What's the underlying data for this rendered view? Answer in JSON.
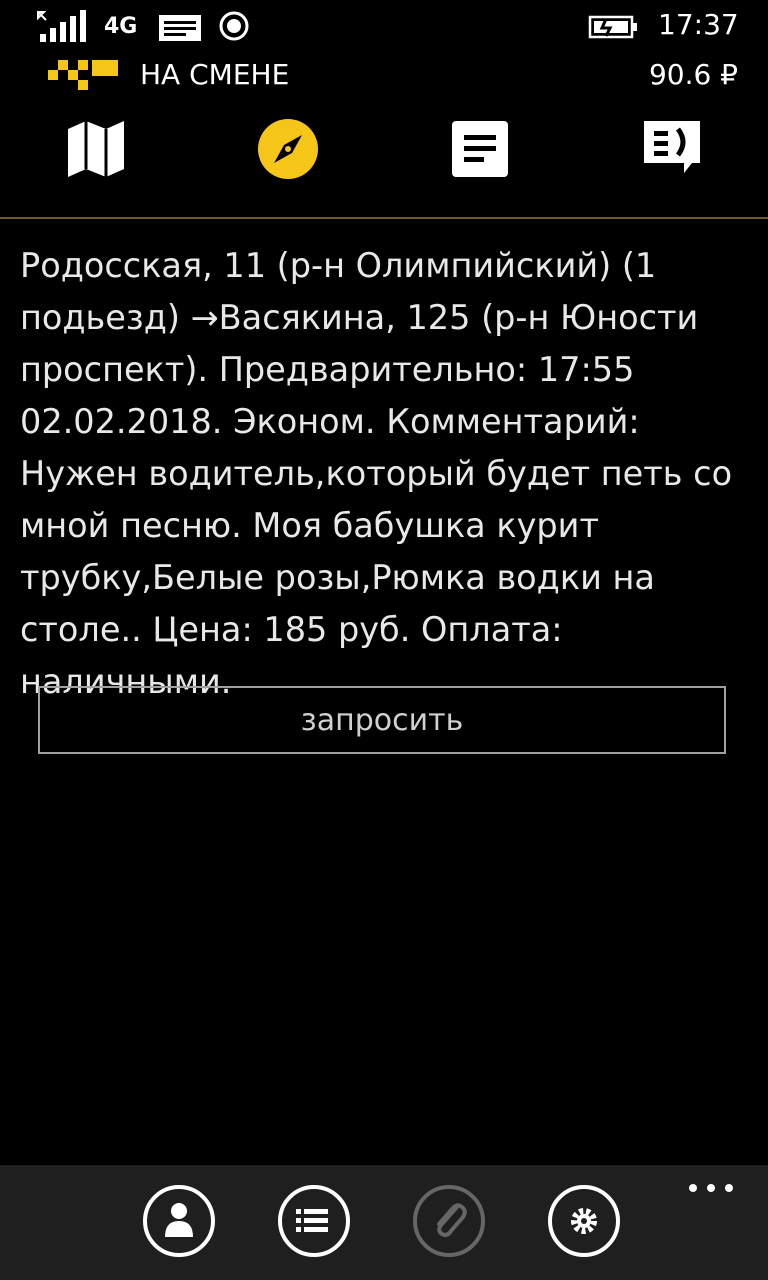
{
  "statusbar": {
    "network": "4G",
    "time": "17:37",
    "icons": [
      "signal-icon",
      "message-icon",
      "location-icon",
      "battery-charging-icon"
    ]
  },
  "header": {
    "status_text": "НА СМЕНЕ",
    "balance": "90.6 ₽",
    "logo_color": "#f5c518"
  },
  "nav": {
    "items": [
      {
        "icon": "map-icon"
      },
      {
        "icon": "compass-icon",
        "active": true
      },
      {
        "icon": "orders-list-icon"
      },
      {
        "icon": "chat-icon"
      }
    ]
  },
  "order": {
    "text": "Родосская, 11 (р-н Олимпийский) (1 подьезд) →Васякина, 125 (р-н Юности проспект). Предварительно:  17:55 02.02.2018. Эконом. Комментарий: Нужен водитель,который будет петь со мной песню. Моя бабушка курит трубку,Белые розы,Рюмка водки на столе.. Цена: 185 руб. Оплата: наличными."
  },
  "request_button": {
    "label": "запросить"
  },
  "appbar": {
    "buttons": [
      "profile-icon",
      "list-icon",
      "attach-icon",
      "settings-icon"
    ],
    "more": "..."
  },
  "colors": {
    "accent": "#f5c518",
    "background": "#000000",
    "appbar": "#1f1f1f",
    "divider": "#6a5a30"
  }
}
